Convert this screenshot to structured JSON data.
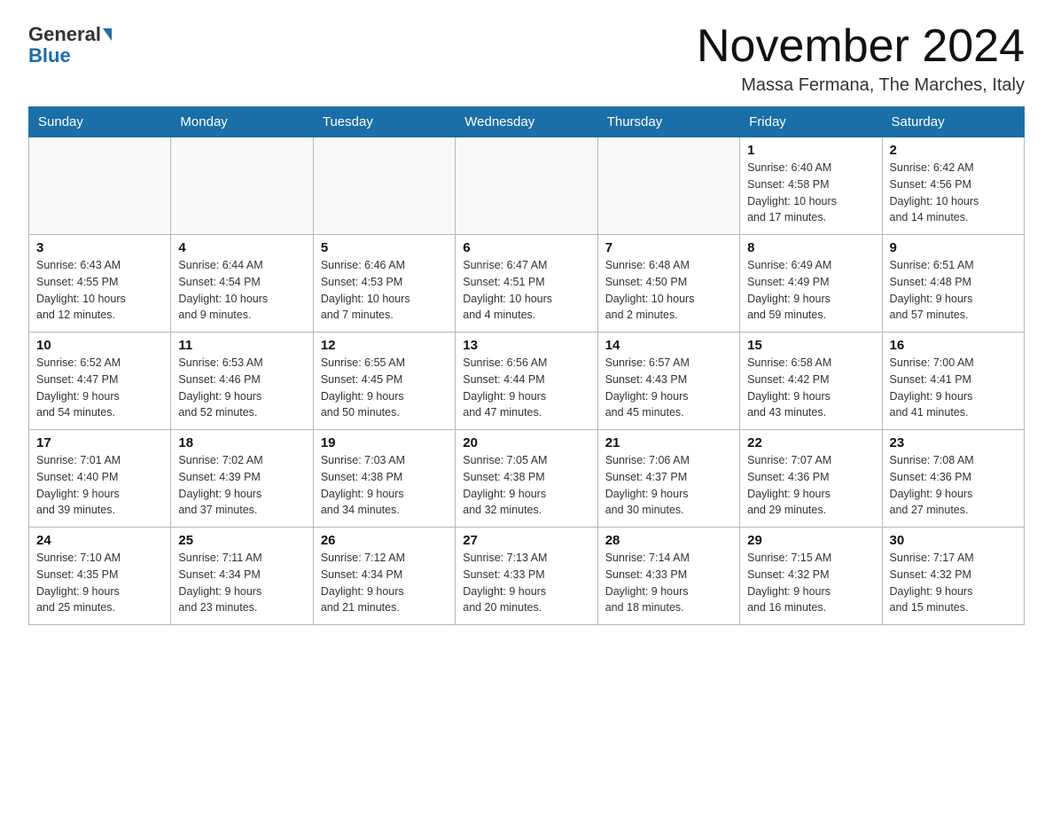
{
  "header": {
    "logo_general": "General",
    "logo_blue": "Blue",
    "month_title": "November 2024",
    "location": "Massa Fermana, The Marches, Italy"
  },
  "weekdays": [
    "Sunday",
    "Monday",
    "Tuesday",
    "Wednesday",
    "Thursday",
    "Friday",
    "Saturday"
  ],
  "weeks": [
    [
      {
        "day": "",
        "info": ""
      },
      {
        "day": "",
        "info": ""
      },
      {
        "day": "",
        "info": ""
      },
      {
        "day": "",
        "info": ""
      },
      {
        "day": "",
        "info": ""
      },
      {
        "day": "1",
        "info": "Sunrise: 6:40 AM\nSunset: 4:58 PM\nDaylight: 10 hours\nand 17 minutes."
      },
      {
        "day": "2",
        "info": "Sunrise: 6:42 AM\nSunset: 4:56 PM\nDaylight: 10 hours\nand 14 minutes."
      }
    ],
    [
      {
        "day": "3",
        "info": "Sunrise: 6:43 AM\nSunset: 4:55 PM\nDaylight: 10 hours\nand 12 minutes."
      },
      {
        "day": "4",
        "info": "Sunrise: 6:44 AM\nSunset: 4:54 PM\nDaylight: 10 hours\nand 9 minutes."
      },
      {
        "day": "5",
        "info": "Sunrise: 6:46 AM\nSunset: 4:53 PM\nDaylight: 10 hours\nand 7 minutes."
      },
      {
        "day": "6",
        "info": "Sunrise: 6:47 AM\nSunset: 4:51 PM\nDaylight: 10 hours\nand 4 minutes."
      },
      {
        "day": "7",
        "info": "Sunrise: 6:48 AM\nSunset: 4:50 PM\nDaylight: 10 hours\nand 2 minutes."
      },
      {
        "day": "8",
        "info": "Sunrise: 6:49 AM\nSunset: 4:49 PM\nDaylight: 9 hours\nand 59 minutes."
      },
      {
        "day": "9",
        "info": "Sunrise: 6:51 AM\nSunset: 4:48 PM\nDaylight: 9 hours\nand 57 minutes."
      }
    ],
    [
      {
        "day": "10",
        "info": "Sunrise: 6:52 AM\nSunset: 4:47 PM\nDaylight: 9 hours\nand 54 minutes."
      },
      {
        "day": "11",
        "info": "Sunrise: 6:53 AM\nSunset: 4:46 PM\nDaylight: 9 hours\nand 52 minutes."
      },
      {
        "day": "12",
        "info": "Sunrise: 6:55 AM\nSunset: 4:45 PM\nDaylight: 9 hours\nand 50 minutes."
      },
      {
        "day": "13",
        "info": "Sunrise: 6:56 AM\nSunset: 4:44 PM\nDaylight: 9 hours\nand 47 minutes."
      },
      {
        "day": "14",
        "info": "Sunrise: 6:57 AM\nSunset: 4:43 PM\nDaylight: 9 hours\nand 45 minutes."
      },
      {
        "day": "15",
        "info": "Sunrise: 6:58 AM\nSunset: 4:42 PM\nDaylight: 9 hours\nand 43 minutes."
      },
      {
        "day": "16",
        "info": "Sunrise: 7:00 AM\nSunset: 4:41 PM\nDaylight: 9 hours\nand 41 minutes."
      }
    ],
    [
      {
        "day": "17",
        "info": "Sunrise: 7:01 AM\nSunset: 4:40 PM\nDaylight: 9 hours\nand 39 minutes."
      },
      {
        "day": "18",
        "info": "Sunrise: 7:02 AM\nSunset: 4:39 PM\nDaylight: 9 hours\nand 37 minutes."
      },
      {
        "day": "19",
        "info": "Sunrise: 7:03 AM\nSunset: 4:38 PM\nDaylight: 9 hours\nand 34 minutes."
      },
      {
        "day": "20",
        "info": "Sunrise: 7:05 AM\nSunset: 4:38 PM\nDaylight: 9 hours\nand 32 minutes."
      },
      {
        "day": "21",
        "info": "Sunrise: 7:06 AM\nSunset: 4:37 PM\nDaylight: 9 hours\nand 30 minutes."
      },
      {
        "day": "22",
        "info": "Sunrise: 7:07 AM\nSunset: 4:36 PM\nDaylight: 9 hours\nand 29 minutes."
      },
      {
        "day": "23",
        "info": "Sunrise: 7:08 AM\nSunset: 4:36 PM\nDaylight: 9 hours\nand 27 minutes."
      }
    ],
    [
      {
        "day": "24",
        "info": "Sunrise: 7:10 AM\nSunset: 4:35 PM\nDaylight: 9 hours\nand 25 minutes."
      },
      {
        "day": "25",
        "info": "Sunrise: 7:11 AM\nSunset: 4:34 PM\nDaylight: 9 hours\nand 23 minutes."
      },
      {
        "day": "26",
        "info": "Sunrise: 7:12 AM\nSunset: 4:34 PM\nDaylight: 9 hours\nand 21 minutes."
      },
      {
        "day": "27",
        "info": "Sunrise: 7:13 AM\nSunset: 4:33 PM\nDaylight: 9 hours\nand 20 minutes."
      },
      {
        "day": "28",
        "info": "Sunrise: 7:14 AM\nSunset: 4:33 PM\nDaylight: 9 hours\nand 18 minutes."
      },
      {
        "day": "29",
        "info": "Sunrise: 7:15 AM\nSunset: 4:32 PM\nDaylight: 9 hours\nand 16 minutes."
      },
      {
        "day": "30",
        "info": "Sunrise: 7:17 AM\nSunset: 4:32 PM\nDaylight: 9 hours\nand 15 minutes."
      }
    ]
  ]
}
